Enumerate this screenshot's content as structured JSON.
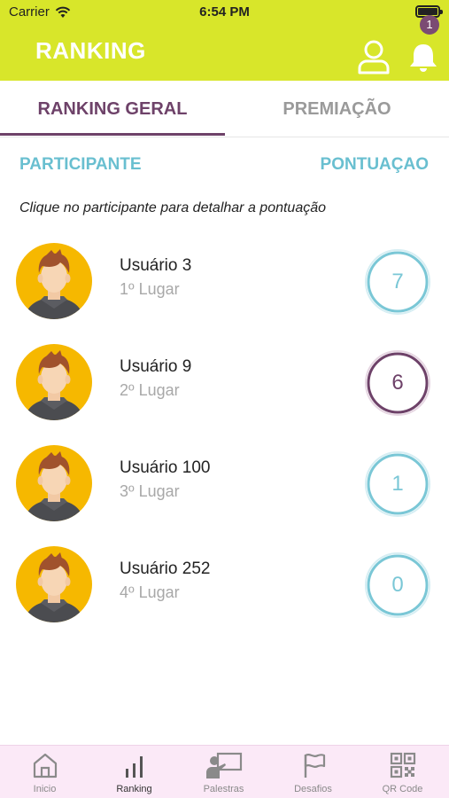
{
  "status_bar": {
    "carrier": "Carrier",
    "time": "6:54 PM"
  },
  "header": {
    "title": "RANKING",
    "notification_count": "1"
  },
  "tabs": [
    {
      "label": "RANKING GERAL",
      "active": true
    },
    {
      "label": "PREMIAÇÃO",
      "active": false
    }
  ],
  "columns": {
    "participant": "PARTICIPANTE",
    "score": "PONTUAÇAO"
  },
  "hint": "Clique no participante para detalhar a pontuação",
  "ranking": [
    {
      "name": "Usuário 3",
      "place": "1º Lugar",
      "score": "7"
    },
    {
      "name": "Usuário 9",
      "place": "2º Lugar",
      "score": "6"
    },
    {
      "name": "Usuário 100",
      "place": "3º Lugar",
      "score": "1"
    },
    {
      "name": "Usuário 252",
      "place": "4º Lugar",
      "score": "0"
    }
  ],
  "bottom_nav": [
    {
      "label": "Inicio",
      "icon": "home-icon"
    },
    {
      "label": "Ranking",
      "icon": "ranking-icon"
    },
    {
      "label": "Palestras",
      "icon": "presentation-icon"
    },
    {
      "label": "Desafios",
      "icon": "flag-icon"
    },
    {
      "label": "QR Code",
      "icon": "qr-code-icon"
    }
  ],
  "colors": {
    "brand_yellow": "#d8e62a",
    "purple": "#6e4269",
    "teal": "#69bfd0",
    "nav_bg": "#fbe9f7"
  }
}
